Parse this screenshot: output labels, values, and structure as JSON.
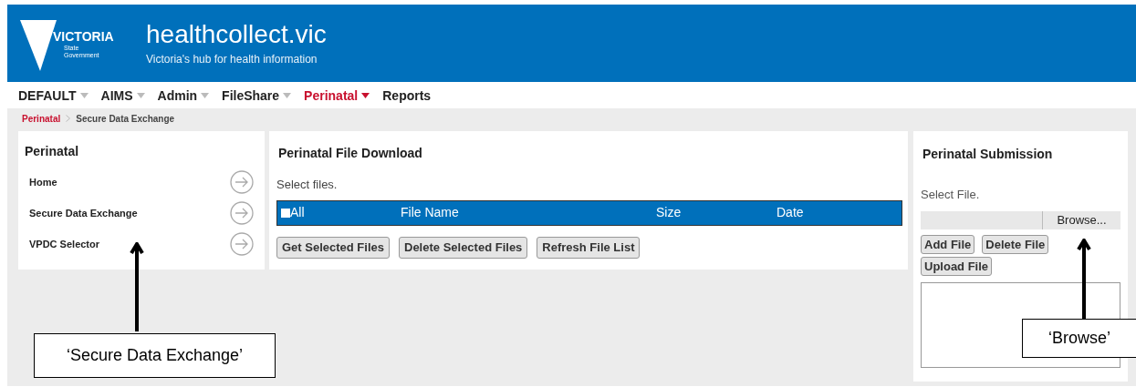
{
  "header": {
    "logo": {
      "word": "VICTORIA",
      "line_1": "State",
      "line_2": "Government"
    },
    "title": "healthcollect.vic",
    "subtitle": "Victoria's hub for health information"
  },
  "menu": [
    {
      "label": "DEFAULT",
      "has_caret": true,
      "selected": false
    },
    {
      "label": "AIMS",
      "has_caret": true,
      "selected": false
    },
    {
      "label": "Admin",
      "has_caret": true,
      "selected": false
    },
    {
      "label": "FileShare",
      "has_caret": true,
      "selected": false
    },
    {
      "label": "Perinatal",
      "has_caret": true,
      "selected": true
    },
    {
      "label": "Reports",
      "has_caret": false,
      "selected": false
    }
  ],
  "breadcrumb": [
    "Perinatal",
    "Secure Data Exchange"
  ],
  "sidebar": {
    "title": "Perinatal",
    "items": [
      "Home",
      "Secure Data Exchange",
      "VPDC Selector"
    ]
  },
  "download": {
    "title": "Perinatal File Download",
    "hint": "Select files.",
    "select_all": {
      "label": "All",
      "checked": false
    },
    "columns": [
      "File Name",
      "Size",
      "Date"
    ],
    "buttons": [
      "Get Selected Files",
      "Delete Selected Files",
      "Refresh File List"
    ]
  },
  "submission": {
    "title": "Perinatal Submission",
    "hint": "Select File.",
    "browse": "Browse...",
    "buttons": [
      "Add File",
      "Delete File",
      "Upload File"
    ]
  },
  "annotations": [
    "‘Secure Data Exchange’",
    "‘Browse’"
  ]
}
